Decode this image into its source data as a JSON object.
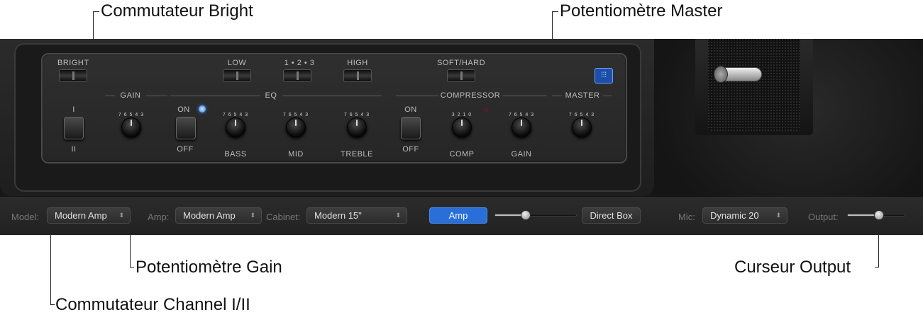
{
  "callouts": {
    "bright": "Commutateur Bright",
    "master": "Potentiomètre Master",
    "gain": "Potentiomètre Gain",
    "output": "Curseur Output",
    "channel": "Commutateur Channel I/II"
  },
  "amp_panel": {
    "bright_label": "BRIGHT",
    "low_label": "LOW",
    "mode_label": "1 • 2 • 3",
    "high_label": "HIGH",
    "softhard_label": "SOFT/HARD",
    "gain_section": "GAIN",
    "eq_section": "EQ",
    "compressor_section": "COMPRESSOR",
    "master_section": "MASTER",
    "channel_top": "I",
    "channel_bottom": "II",
    "eq_on": "ON",
    "eq_off": "OFF",
    "comp_on": "ON",
    "comp_off": "OFF",
    "knob_labels": {
      "bass": "BASS",
      "mid": "MID",
      "treble": "TREBLE",
      "comp": "COMP",
      "comp_gain": "GAIN"
    },
    "knob_scale": "7 6 5 4 3",
    "comp_scale": "3 2 1 0",
    "eq_button_icon": "graphic-eq-icon"
  },
  "bottom_bar": {
    "model_label": "Model:",
    "model_value": "Modern Amp",
    "amp_label": "Amp:",
    "amp_value": "Modern Amp",
    "cabinet_label": "Cabinet:",
    "cabinet_value": "Modern 15\"",
    "amp_button": "Amp",
    "direct_box_button": "Direct Box",
    "mic_label": "Mic:",
    "mic_value": "Dynamic 20",
    "output_label": "Output:",
    "amp_blend_level": 0.38,
    "output_level": 0.55
  },
  "colors": {
    "accent_blue": "#2a6fd8",
    "led_blue": "#3b8bff"
  }
}
